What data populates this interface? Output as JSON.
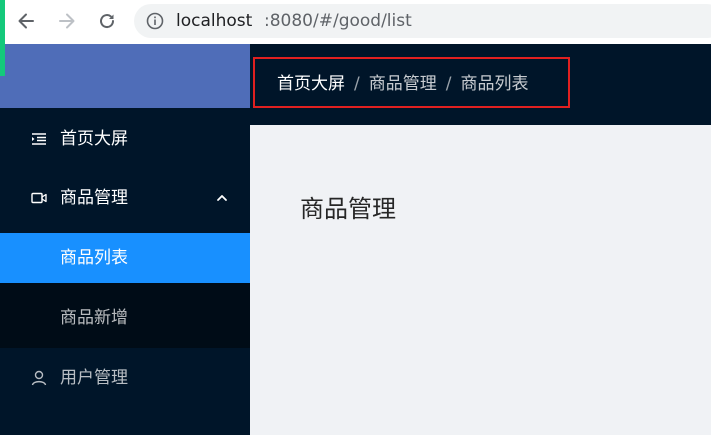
{
  "browser": {
    "url_host": "localhost",
    "url_rest": ":8080/#/good/list"
  },
  "sidebar": {
    "items": [
      {
        "label": "首页大屏",
        "icon": "menu-fold-icon"
      },
      {
        "label": "商品管理",
        "icon": "video-camera-icon",
        "expanded": true,
        "children": [
          {
            "label": "商品列表",
            "selected": true
          },
          {
            "label": "商品新增",
            "selected": false
          }
        ]
      },
      {
        "label": "用户管理",
        "icon": "user-icon"
      }
    ]
  },
  "header": {
    "breadcrumb": [
      "首页大屏",
      "商品管理",
      "商品列表"
    ],
    "separator": "/"
  },
  "main": {
    "title": "商品管理"
  },
  "colors": {
    "sidebar_bg": "#001529",
    "submenu_bg": "#000c17",
    "selected_bg": "#1890ff",
    "logo_bg": "#4f6db8",
    "highlight_border": "#e02020",
    "content_bg": "#f0f2f5"
  }
}
